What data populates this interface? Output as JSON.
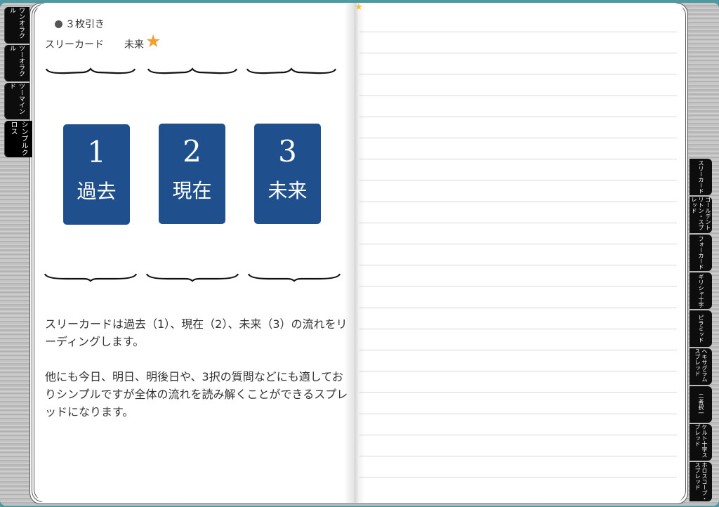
{
  "left_tabs": [
    "ワンオラクル",
    "ツーオラクル",
    "ツーマインド",
    "シンプルクロス"
  ],
  "active_left_tab": "シンプルクロス",
  "right_tabs": [
    "スリーカード",
    "ゴールデントリトン・スプレッド",
    "フォーカード",
    "ギリシャ十字",
    "ピラミッド",
    "ヘキサグラムスプレッド",
    "二者択一",
    "ケルト十字スプレッド",
    "ホロスコープ・スプレッド"
  ],
  "section_title": "３枚引き",
  "spread_name": "スリーカード",
  "rating_label": "未来",
  "rating_icon": "star-icon",
  "cards": [
    {
      "number": "1",
      "label": "過去"
    },
    {
      "number": "2",
      "label": "現在"
    },
    {
      "number": "3",
      "label": "未来"
    }
  ],
  "description": [
    "スリーカードは過去（1）、現在（2）、未来（3）の流れをリーディングします。",
    "他にも今日、明日、明後日や、3択の質問などにも適しておりシンプルですが全体の流れを読み解くことができるスプレッドになります。"
  ],
  "colors": {
    "card": "#1f4f8c",
    "star": "#f0a030",
    "tab": "#0d0d0d"
  }
}
